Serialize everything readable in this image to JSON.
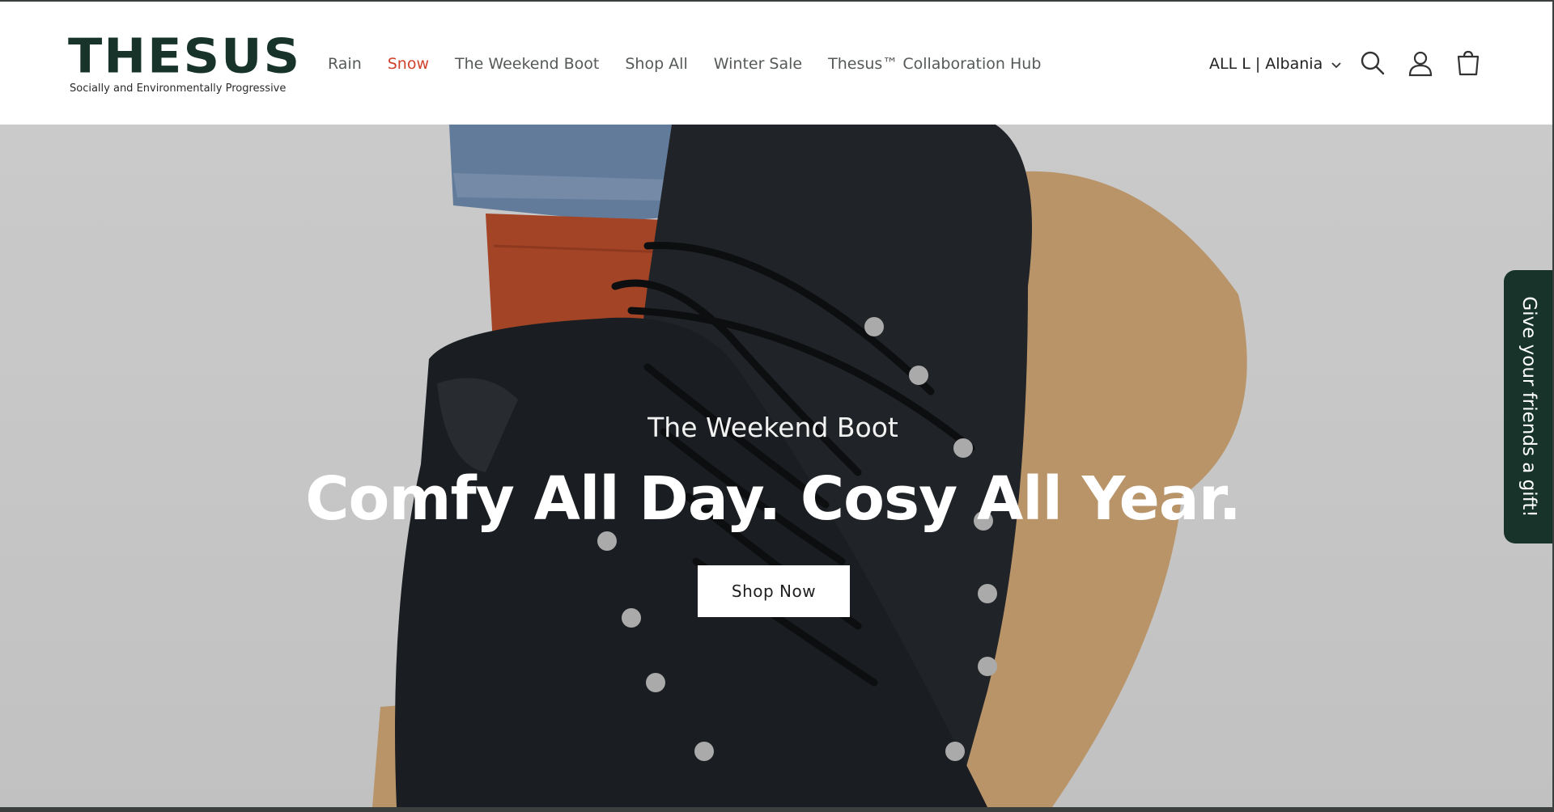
{
  "brand": {
    "name": "THESUS",
    "tagline": "Socially and Environmentally Progressive",
    "color": "#17332a"
  },
  "nav": {
    "items": [
      {
        "label": "Rain"
      },
      {
        "label": "Snow"
      },
      {
        "label": "The Weekend Boot"
      },
      {
        "label": "Shop All"
      },
      {
        "label": "Winter Sale"
      },
      {
        "label": "Thesus™ Collaboration Hub"
      }
    ],
    "active_color": "#d0432b"
  },
  "header": {
    "locale_label": "ALL L | Albania",
    "icons": [
      "search-icon",
      "account-icon",
      "cart-icon"
    ]
  },
  "hero": {
    "subtitle": "The Weekend Boot",
    "title": "Comfy All Day. Cosy All Year.",
    "cta_label": "Shop Now"
  },
  "gift_tab": {
    "label": "Give your friends a gift!"
  }
}
